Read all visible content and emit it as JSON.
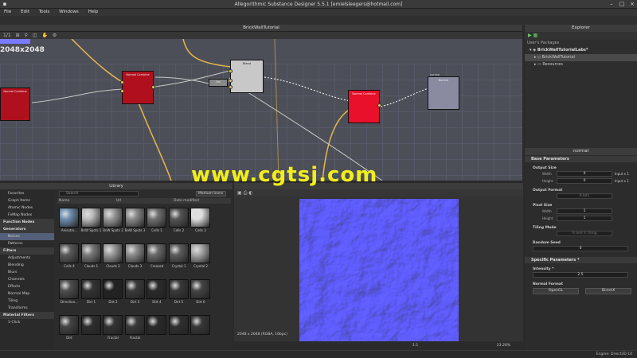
{
  "window": {
    "title": "Allegorithmic Substance Designer 5.5.1 [emielsleegers@hotmail.com]"
  },
  "menu": [
    "File",
    "Edit",
    "Tools",
    "Windows",
    "Help"
  ],
  "graph": {
    "title": "BrickWallTutorial",
    "resolution": "2048x2048",
    "zoom_label": "1/1",
    "nodes": {
      "left": "Normal Combine",
      "mid": "Normal Combine",
      "blend": "Blend",
      "small": "Uni",
      "normal": "Normal Combine",
      "output": "Normal",
      "output_header": "normal"
    }
  },
  "explorer": {
    "title": "Explorer",
    "section": "User's Packages",
    "package": "BrickWallTutorialLabs*",
    "graph": "BrickWallTutorial",
    "resources": "Resources"
  },
  "params": {
    "title": "normal",
    "base": "Base Parameters",
    "output_size": "Output Size",
    "width_label": "Width",
    "height_label": "Height",
    "width_value": "0",
    "height_value": "0",
    "width_extra": "Input x 1",
    "height_extra": "Input x 1",
    "output_format": "Output Format",
    "format_value": "8 bits",
    "pixel_size": "Pixel Size",
    "ps_width": "1",
    "ps_height": "1",
    "tiling_mode": "Tiling Mode",
    "tiling_value": "H and V Tiling",
    "random_seed": "Random Seed",
    "seed_value": "0",
    "specific": "Specific Parameters *",
    "intensity": "Intensity *",
    "intensity_value": "2.5",
    "normal_format": "Normal Format",
    "fmt_opengl": "OpenGL",
    "fmt_directx": "DirectX"
  },
  "library": {
    "title": "Library",
    "search_placeholder": "Search",
    "mode": "Medium Icons",
    "col_name": "Name",
    "col_url": "Url",
    "col_date": "Date modified",
    "sidebar": [
      {
        "label": "Favorites",
        "type": "item"
      },
      {
        "label": "Graph Items",
        "type": "item"
      },
      {
        "label": "Atomic Nodes",
        "type": "item"
      },
      {
        "label": "FxMap Nodes",
        "type": "item"
      },
      {
        "label": "Function Nodes",
        "type": "cat"
      },
      {
        "label": "Generators",
        "type": "cat"
      },
      {
        "label": "Noises",
        "type": "sel"
      },
      {
        "label": "Patterns",
        "type": "item"
      },
      {
        "label": "Filters",
        "type": "cat"
      },
      {
        "label": "Adjustments",
        "type": "item"
      },
      {
        "label": "Blending",
        "type": "item"
      },
      {
        "label": "Blurs",
        "type": "item"
      },
      {
        "label": "Channels",
        "type": "item"
      },
      {
        "label": "Effects",
        "type": "item"
      },
      {
        "label": "Normal Map",
        "type": "item"
      },
      {
        "label": "Tiling",
        "type": "item"
      },
      {
        "label": "Transforms",
        "type": "item"
      },
      {
        "label": "Material Filters",
        "type": "cat"
      },
      {
        "label": "1-Click",
        "type": "item"
      }
    ],
    "thumbs": [
      [
        "Anisotro...",
        "BnW Spots 1",
        "BnW Spots 2",
        "BnW Spots 3",
        "Cells 1",
        "Cells 2",
        "Cells 3"
      ],
      [
        "Cells 4",
        "Clouds 1",
        "Clouds 2",
        "Clouds 3",
        "Creased",
        "Crystal 1",
        "Crystal 2"
      ],
      [
        "Direction...",
        "Dirt 1",
        "Dirt 2",
        "Dirt 3",
        "Dirt 4",
        "Dirt 5",
        "Dirt 6"
      ],
      [
        "Dirt",
        "",
        "Fractal",
        "Fractal",
        "",
        "",
        ""
      ]
    ]
  },
  "view2d": {
    "info": "2048 x 2048 (RGBA, 16bpc)",
    "zoom": "23.26%",
    "ratio": "1:1"
  },
  "status": {
    "engine": "Engine: Direct3D 10"
  },
  "watermark": "www.cgtsj.com",
  "colors": {
    "node_red": "#b0101e",
    "node_bright_red": "#e8102a",
    "node_gray": "#c8c8c8",
    "node_purple": "#8a8aa0",
    "wire_yellow": "#e6b84a",
    "watermark": "#f2ee1a",
    "normal_map": "#8080ff"
  }
}
